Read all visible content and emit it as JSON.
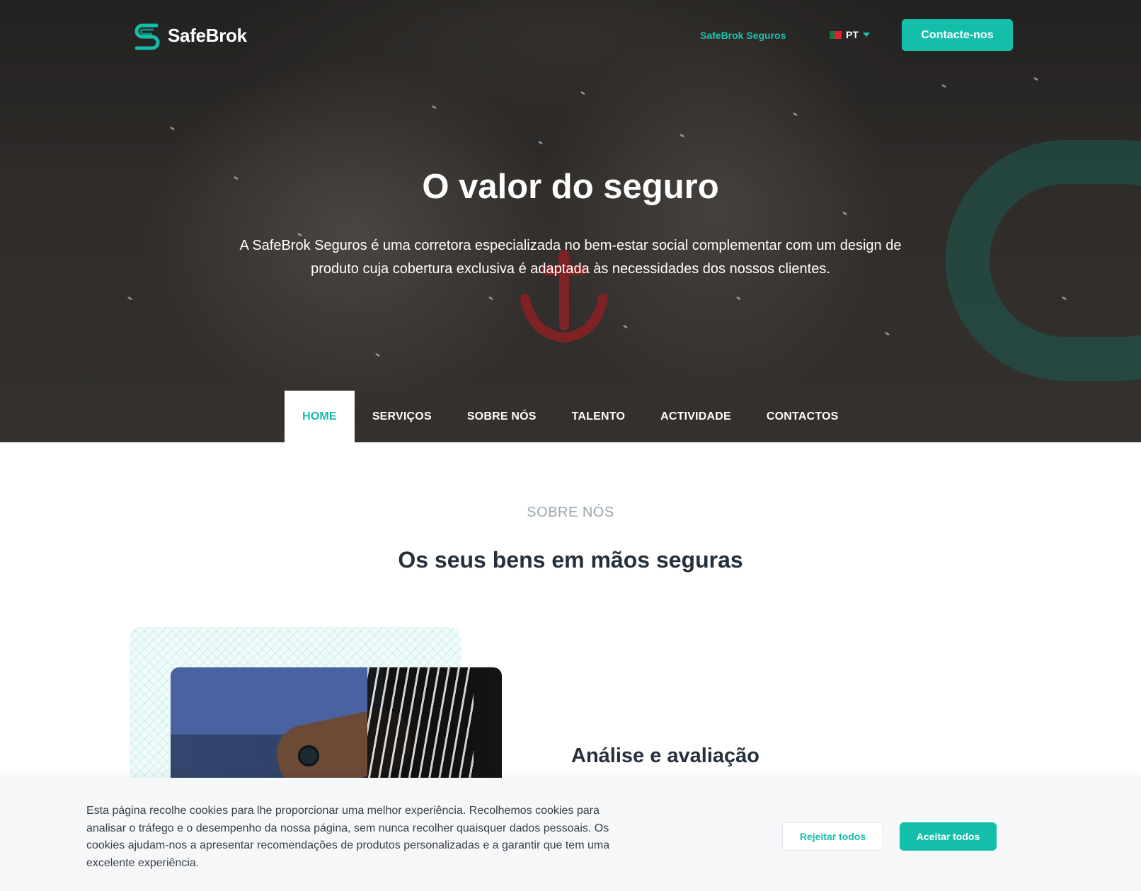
{
  "brand": {
    "name": "SafeBrok",
    "accent": "#14bfaa",
    "logo_icon": "safebrok-logo-icon"
  },
  "header": {
    "top_link": "SafeBrok Seguros",
    "language": "PT",
    "flag_icon": "portugal-flag-icon",
    "contact_button": "Contacte-nos"
  },
  "hero": {
    "title": "O valor do seguro",
    "subtitle": "A SafeBrok Seguros é uma corretora especializada no bem-estar social complementar com um design de produto cuja cobertura exclusiva é adaptada às necessidades dos nossos clientes."
  },
  "nav": {
    "items": [
      "HOME",
      "SERVIÇOS",
      "SOBRE NÓS",
      "TALENTO",
      "ACTIVIDADE",
      "CONTACTOS"
    ],
    "active": "HOME"
  },
  "about": {
    "kicker": "SOBRE NÓS",
    "title": "Os seus bens em mãos seguras",
    "feature_title": "Análise e avaliação"
  },
  "cookie": {
    "text": "Esta página recolhe cookies para lhe proporcionar uma melhor experiência. Recolhemos cookies para analisar o tráfego e o desempenho da nossa página, sem nunca recolher quaisquer dados pessoais. Os cookies ajudam-nos a apresentar recomendações de produtos personalizadas e a garantir que tem uma excelente experiência.",
    "reject": "Rejeitar todos",
    "accept": "Aceitar todos"
  }
}
